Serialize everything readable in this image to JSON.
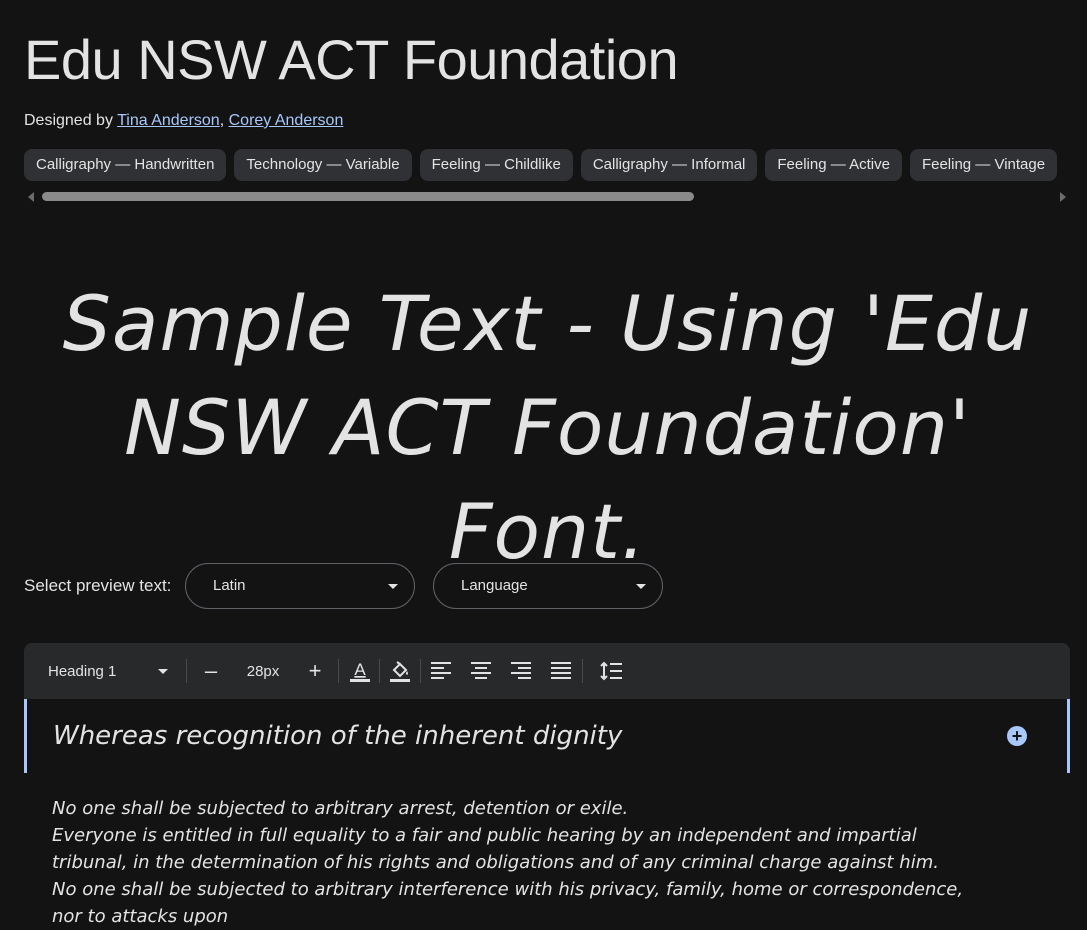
{
  "font": {
    "title": "Edu NSW ACT Foundation",
    "designed_by_label": "Designed by",
    "designer_separator": ",",
    "designers": [
      "Tina Anderson",
      "Corey Anderson"
    ]
  },
  "tags": [
    "Calligraphy — Handwritten",
    "Technology — Variable",
    "Feeling — Childlike",
    "Calligraphy — Informal",
    "Feeling — Active",
    "Feeling — Vintage"
  ],
  "sample_text": "Sample Text - Using 'Edu NSW ACT Foundation' Font.",
  "preview": {
    "label": "Select preview text:",
    "script_select": "Latin",
    "language_select": "Language"
  },
  "toolbar": {
    "style": "Heading 1",
    "minus": "–",
    "font_size": "28px",
    "plus": "+",
    "icons": [
      "text-color-icon",
      "fill-color-icon",
      "align-left-icon",
      "align-center-icon",
      "align-right-icon",
      "align-justify-icon",
      "line-spacing-icon"
    ]
  },
  "editor": {
    "heading": "Whereas recognition of the inherent dignity",
    "paragraphs": [
      "No one shall be subjected to arbitrary arrest, detention or exile.",
      "Everyone is entitled in full equality to a fair and public hearing by an independent and impartial tribunal, in the determination of his rights and obligations and of any criminal charge against him.",
      "No one shall be subjected to arbitrary interference with his privacy, family, home or correspondence, nor to attacks upon"
    ]
  },
  "colors": {
    "background": "#131314",
    "text": "#e3e3e3",
    "link": "#a8c7fa",
    "chip_bg": "#303134",
    "toolbar_bg": "#28292a",
    "accent": "#a8c7fa"
  }
}
